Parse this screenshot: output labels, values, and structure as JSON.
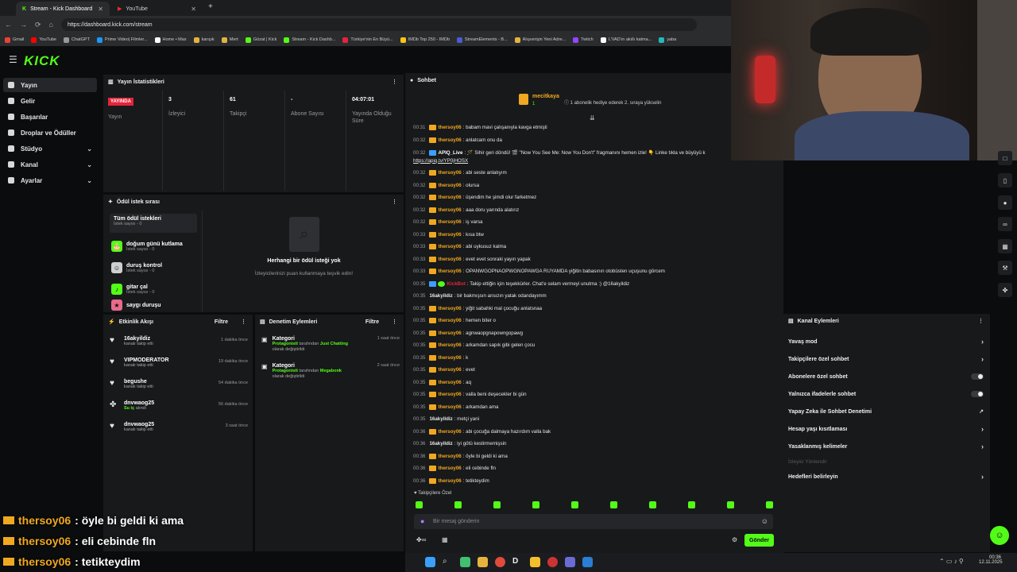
{
  "browser": {
    "tabs": [
      {
        "title": "Stream - Kick Dashboard",
        "active": true
      },
      {
        "title": "YouTube",
        "active": false
      }
    ],
    "url": "https://dashboard.kick.com/stream",
    "bookmarks": [
      "Gmail",
      "YouTube",
      "ChatGPT",
      "Prime Video| Filmler...",
      "Home • Max",
      "karışık",
      "Mert",
      "Gözat | Kick",
      "Stream - Kick Dashb...",
      "Türkiye'nin En Büyü...",
      "IMDb Top 250 - IMDb",
      "StreamElements - B...",
      "Alışverişin Yeni Adre...",
      "Twitch",
      "L'VAD'ın akıllı katma...",
      "yaba"
    ]
  },
  "app": {
    "logo": "KICK"
  },
  "sidebar": {
    "items": [
      {
        "label": "Yayın",
        "active": true
      },
      {
        "label": "Gelir"
      },
      {
        "label": "Başarılar"
      },
      {
        "label": "Droplar ve Ödüller"
      },
      {
        "label": "Stüdyo",
        "expandable": true
      },
      {
        "label": "Kanal",
        "expandable": true
      },
      {
        "label": "Ayarlar",
        "expandable": true
      }
    ]
  },
  "stats": {
    "title": "Yayın İstatistikleri",
    "items": [
      {
        "value": "YAYINDA",
        "label": "Yayın"
      },
      {
        "value": "3",
        "label": "İzleyici"
      },
      {
        "value": "61",
        "label": "Takipçi"
      },
      {
        "value": "-",
        "label": "Abone Sayısı"
      },
      {
        "value": "04:07:01",
        "label": "Yayında Olduğu Süre"
      }
    ]
  },
  "rewards": {
    "title": "Ödül istek sırası",
    "all_label": "Tüm ödül istekleri",
    "all_count": "İstek sayısı - 0",
    "items": [
      {
        "title": "doğum günü kutlama",
        "count": "İstek sayısı - 0"
      },
      {
        "title": "duruş kontrol",
        "count": "İstek sayısı - 0"
      },
      {
        "title": "gitar çal",
        "count": "İstek sayısı - 0"
      },
      {
        "title": "saygı duruşu",
        "count": ""
      }
    ],
    "empty_title": "Herhangi bir ödül isteği yok",
    "empty_sub": "İzleyicilerinizi puan kullanmaya teşvik edin!"
  },
  "activity": {
    "title": "Etkinlik Akışı",
    "filter": "Filtre",
    "items": [
      {
        "name": "16akyildiz",
        "desc": "kanalı takip etti",
        "time": "1 dakika önce"
      },
      {
        "name": "VIPMODERATOR",
        "desc": "kanalı takip etti",
        "time": "19 dakika önce"
      },
      {
        "name": "begushe",
        "desc": "kanalı takip etti",
        "time": "54 dakika önce"
      },
      {
        "name": "dnvwaog25",
        "desc": "alındı",
        "prefix": "Su iç",
        "time": "56 dakika önce"
      },
      {
        "name": "dnvwaog25",
        "desc": "kanalı takip etti",
        "time": "3 saat önce"
      }
    ]
  },
  "moderation": {
    "title": "Denetim Eylemleri",
    "filter": "Filtre",
    "items": [
      {
        "title": "Kategori",
        "user": "Protagonistt",
        "mid": "tarafından",
        "target": "Just Chatting",
        "rest": "olarak değiştirildi",
        "time": "1 saat önce"
      },
      {
        "title": "Kategori",
        "user": "Protagonistt",
        "mid": "tarafından",
        "target": "Megabonk",
        "rest": "olarak değiştirildi",
        "time": "2 saat önce"
      }
    ]
  },
  "chat": {
    "title": "Sohbet",
    "pinned_user": "mecitkaya",
    "pinned_rank": "1",
    "pinned_text": "1 abonelik hediye ederek 2. sıraya yükselin",
    "messages": [
      {
        "t": "00:31",
        "u": "thersoy06",
        "m": ": babam mavi çalışanıyla kavga etmişti"
      },
      {
        "t": "00:32",
        "u": "thersoy06",
        "m": ": anlatcam onu da"
      },
      {
        "t": "00:32",
        "u": "APIQ_Live",
        "m": ": 🪄 Sihir geri döndü! 🎬 \"Now You See Me: Now You Don't\" fragmanını hemen izle! 👇 Linke tıkla ve büyüyü k",
        "bot": true
      },
      {
        "t": "",
        "u": "",
        "m": "https://apiq.tv/YP0jHOSX",
        "link": true
      },
      {
        "t": "00:32",
        "u": "thersoy06",
        "m": ": abi seste anlatıyım"
      },
      {
        "t": "00:32",
        "u": "thersoy06",
        "m": ": olursa"
      },
      {
        "t": "00:32",
        "u": "thersoy06",
        "m": ": üşendim he şimdi olur farketmez"
      },
      {
        "t": "00:32",
        "u": "thersoy06",
        "m": ": aaa doru yarında alatırız"
      },
      {
        "t": "00:32",
        "u": "thersoy06",
        "m": ": iş varsa"
      },
      {
        "t": "00:33",
        "u": "thersoy06",
        "m": ": kısa btw"
      },
      {
        "t": "00:33",
        "u": "thersoy06",
        "m": ": abi uykusuz kalma"
      },
      {
        "t": "00:33",
        "u": "thersoy06",
        "m": ": evet evet sonraki yayın yapak"
      },
      {
        "t": "00:33",
        "u": "thersoy06",
        "m": ": OPANWGOPNAOPWGNOPAWGA RÜYAMDA yiğitin babasının otobüsten uçuşunu görcem"
      },
      {
        "t": "00:35",
        "u": "KickBot",
        "m": ": Takip ettiğin için teşekkürler. Chat'e selam vermeyi unutma :) @16akyildiz",
        "bot": true,
        "red": true
      },
      {
        "t": "00:35",
        "u": "16akyildiz",
        "m": ": bir bakmışsın ansızın yatak odandayımm",
        "plain": true
      },
      {
        "t": "00:35",
        "u": "thersoy06",
        "m": ": yiğit sabahki mal çocuğu anlatsnaa"
      },
      {
        "t": "00:35",
        "u": "thersoy06",
        "m": ": hemen biter o"
      },
      {
        "t": "00:35",
        "u": "thersoy06",
        "m": ": agnwaopgnapowngopawg"
      },
      {
        "t": "00:35",
        "u": "thersoy06",
        "m": ": arkamdan sapık gibi gelen çocu"
      },
      {
        "t": "00:35",
        "u": "thersoy06",
        "m": ": k"
      },
      {
        "t": "00:35",
        "u": "thersoy06",
        "m": ": evet"
      },
      {
        "t": "00:35",
        "u": "thersoy06",
        "m": ": aq"
      },
      {
        "t": "00:35",
        "u": "thersoy06",
        "m": ": valla beni deşecekler bi gün"
      },
      {
        "t": "00:35",
        "u": "thersoy06",
        "m": ": arkamdan ama"
      },
      {
        "t": "00:35",
        "u": "16akyildiz",
        "m": ": metçi yani",
        "plain": true
      },
      {
        "t": "00:36",
        "u": "thersoy06",
        "m": ": abi çocuğa dalmaya hazırdım valla bak"
      },
      {
        "t": "00:36",
        "u": "16akyildiz",
        "m": ": iyi götü kestirmemişsin",
        "plain": true
      },
      {
        "t": "00:36",
        "u": "thersoy06",
        "m": ": öyle bi geldi ki ama"
      },
      {
        "t": "00:36",
        "u": "thersoy06",
        "m": ": eli cebinde fln"
      },
      {
        "t": "00:36",
        "u": "thersoy06",
        "m": ": tetikteydim"
      }
    ],
    "followers_only": "Takipçilere Özel",
    "input_placeholder": "Bir mesaj gönderin",
    "send_label": "Gönder"
  },
  "channel_actions": {
    "title": "Kanal Eylemleri",
    "items": [
      {
        "label": "Yavaş mod",
        "kind": "arrow"
      },
      {
        "label": "Takipçilere özel sohbet",
        "kind": "arrow"
      },
      {
        "label": "Abonelere özel sohbet",
        "kind": "toggle"
      },
      {
        "label": "Yalnızca ifadelerle sohbet",
        "kind": "toggle"
      },
      {
        "label": "Yapay Zeka ile Sohbet Denetimi",
        "kind": "ext"
      },
      {
        "label": "Hesap yaşı kısıtlaması",
        "kind": "arrow"
      },
      {
        "label": "Yasaklanmış kelimeler",
        "kind": "arrow"
      },
      {
        "label": "İzleyici Yönlendir",
        "kind": "disabled"
      },
      {
        "label": "Hedefleri belirleyin",
        "kind": "arrow"
      }
    ]
  },
  "overlay": {
    "lines": [
      {
        "u": "thersoy06",
        "m": ": öyle bi geldi ki ama"
      },
      {
        "u": "thersoy06",
        "m": ": eli cebinde fln"
      },
      {
        "u": "thersoy06",
        "m": ": tetikteydim"
      }
    ]
  },
  "taskbar": {
    "time": "00:36",
    "date": "12.11.2025"
  },
  "colors": {
    "accent": "#53fc18",
    "live": "#e4243a",
    "username": "#f0a820",
    "panel": "#18191b"
  }
}
